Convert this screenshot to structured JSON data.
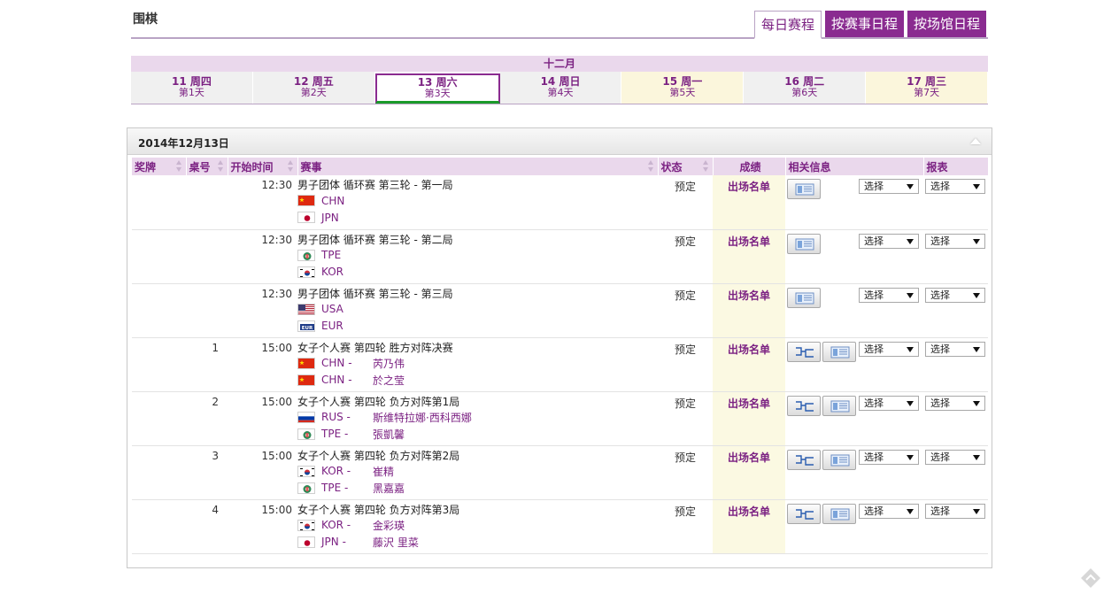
{
  "header": {
    "title": "围棋"
  },
  "view_tabs": [
    "每日赛程",
    "按赛事日程",
    "按场馆日程"
  ],
  "month": "十二月",
  "days": [
    {
      "name": "11 周四",
      "sub": "第1天"
    },
    {
      "name": "12 周五",
      "sub": "第2天"
    },
    {
      "name": "13 周六",
      "sub": "第3天"
    },
    {
      "name": "14 周日",
      "sub": "第4天"
    },
    {
      "name": "15 周一",
      "sub": "第5天"
    },
    {
      "name": "16 周二",
      "sub": "第6天"
    },
    {
      "name": "17 周三",
      "sub": "第7天"
    }
  ],
  "panel": {
    "date": "2014年12月13日"
  },
  "columns": {
    "medal": "奖牌",
    "table": "桌号",
    "start": "开始时间",
    "event": "赛事",
    "status": "状态",
    "results": "成绩",
    "info": "相关信息",
    "report": "报表"
  },
  "rows": [
    {
      "table": "",
      "time": "12:30",
      "event": "男子团体 循环赛 第三轮 - 第一局",
      "status": "预定",
      "results": "出场名单",
      "lines": [
        {
          "flag": "CHN",
          "code": "CHN",
          "player": ""
        },
        {
          "flag": "JPN",
          "code": "JPN",
          "player": ""
        }
      ]
    },
    {
      "table": "",
      "time": "12:30",
      "event": "男子团体 循环赛 第三轮 - 第二局",
      "status": "预定",
      "results": "出场名单",
      "lines": [
        {
          "flag": "TPE",
          "code": "TPE",
          "player": ""
        },
        {
          "flag": "KOR",
          "code": "KOR",
          "player": ""
        }
      ]
    },
    {
      "table": "",
      "time": "12:30",
      "event": "男子团体 循环赛 第三轮 - 第三局",
      "status": "预定",
      "results": "出场名单",
      "lines": [
        {
          "flag": "USA",
          "code": "USA",
          "player": ""
        },
        {
          "flag": "EUR",
          "code": "EUR",
          "player": ""
        }
      ]
    },
    {
      "table": "1",
      "time": "15:00",
      "event": "女子个人赛 第四轮 胜方对阵决赛",
      "status": "预定",
      "results": "出场名单",
      "lines": [
        {
          "flag": "CHN",
          "code": "CHN -",
          "player": "芮乃伟"
        },
        {
          "flag": "CHN",
          "code": "CHN -",
          "player": "於之莹"
        }
      ]
    },
    {
      "table": "2",
      "time": "15:00",
      "event": "女子个人赛 第四轮 负方对阵第1局",
      "status": "预定",
      "results": "出场名单",
      "lines": [
        {
          "flag": "RUS",
          "code": "RUS -",
          "player": "斯维特拉娜·西科西娜"
        },
        {
          "flag": "TPE",
          "code": "TPE -",
          "player": "張凱馨"
        }
      ]
    },
    {
      "table": "3",
      "time": "15:00",
      "event": "女子个人赛 第四轮 负方对阵第2局",
      "status": "预定",
      "results": "出场名单",
      "lines": [
        {
          "flag": "KOR",
          "code": "KOR -",
          "player": "崔精"
        },
        {
          "flag": "TPE",
          "code": "TPE -",
          "player": "黑嘉嘉"
        }
      ]
    },
    {
      "table": "4",
      "time": "15:00",
      "event": "女子个人赛 第四轮 负方对阵第3局",
      "status": "预定",
      "results": "出场名单",
      "lines": [
        {
          "flag": "KOR",
          "code": "KOR -",
          "player": "金彩瑛"
        },
        {
          "flag": "JPN",
          "code": "JPN -",
          "player": "藤沢 里菜"
        }
      ]
    }
  ],
  "select_label": "选择",
  "colors": {
    "accent": "#7b2182",
    "header_bg": "#ead8ec",
    "results_bg": "#fbf9e2",
    "today_underline": "#1a9a2a"
  }
}
